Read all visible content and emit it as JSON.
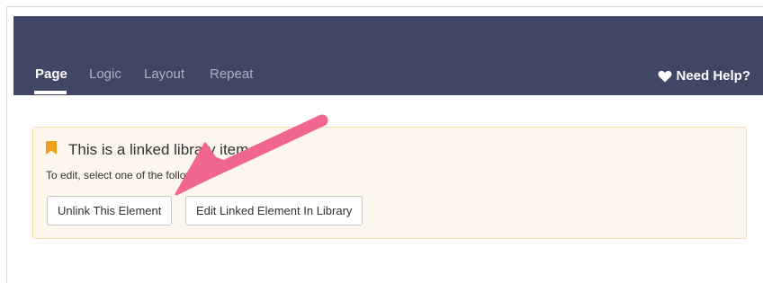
{
  "header": {
    "tabs": [
      {
        "label": "Page",
        "active": true
      },
      {
        "label": "Logic",
        "active": false
      },
      {
        "label": "Layout",
        "active": false
      },
      {
        "label": "Repeat",
        "active": false
      }
    ],
    "help_label": "Need Help?"
  },
  "notice": {
    "title": "This is a linked library item",
    "subtitle": "To edit, select one of the following:",
    "buttons": {
      "unlink": "Unlink This Element",
      "edit_library": "Edit Linked Element In Library"
    }
  },
  "colors": {
    "header_bg": "#3f4765",
    "panel_bg": "#fdf6ec",
    "bookmark": "#f0a020",
    "arrow": "#f0668e"
  }
}
